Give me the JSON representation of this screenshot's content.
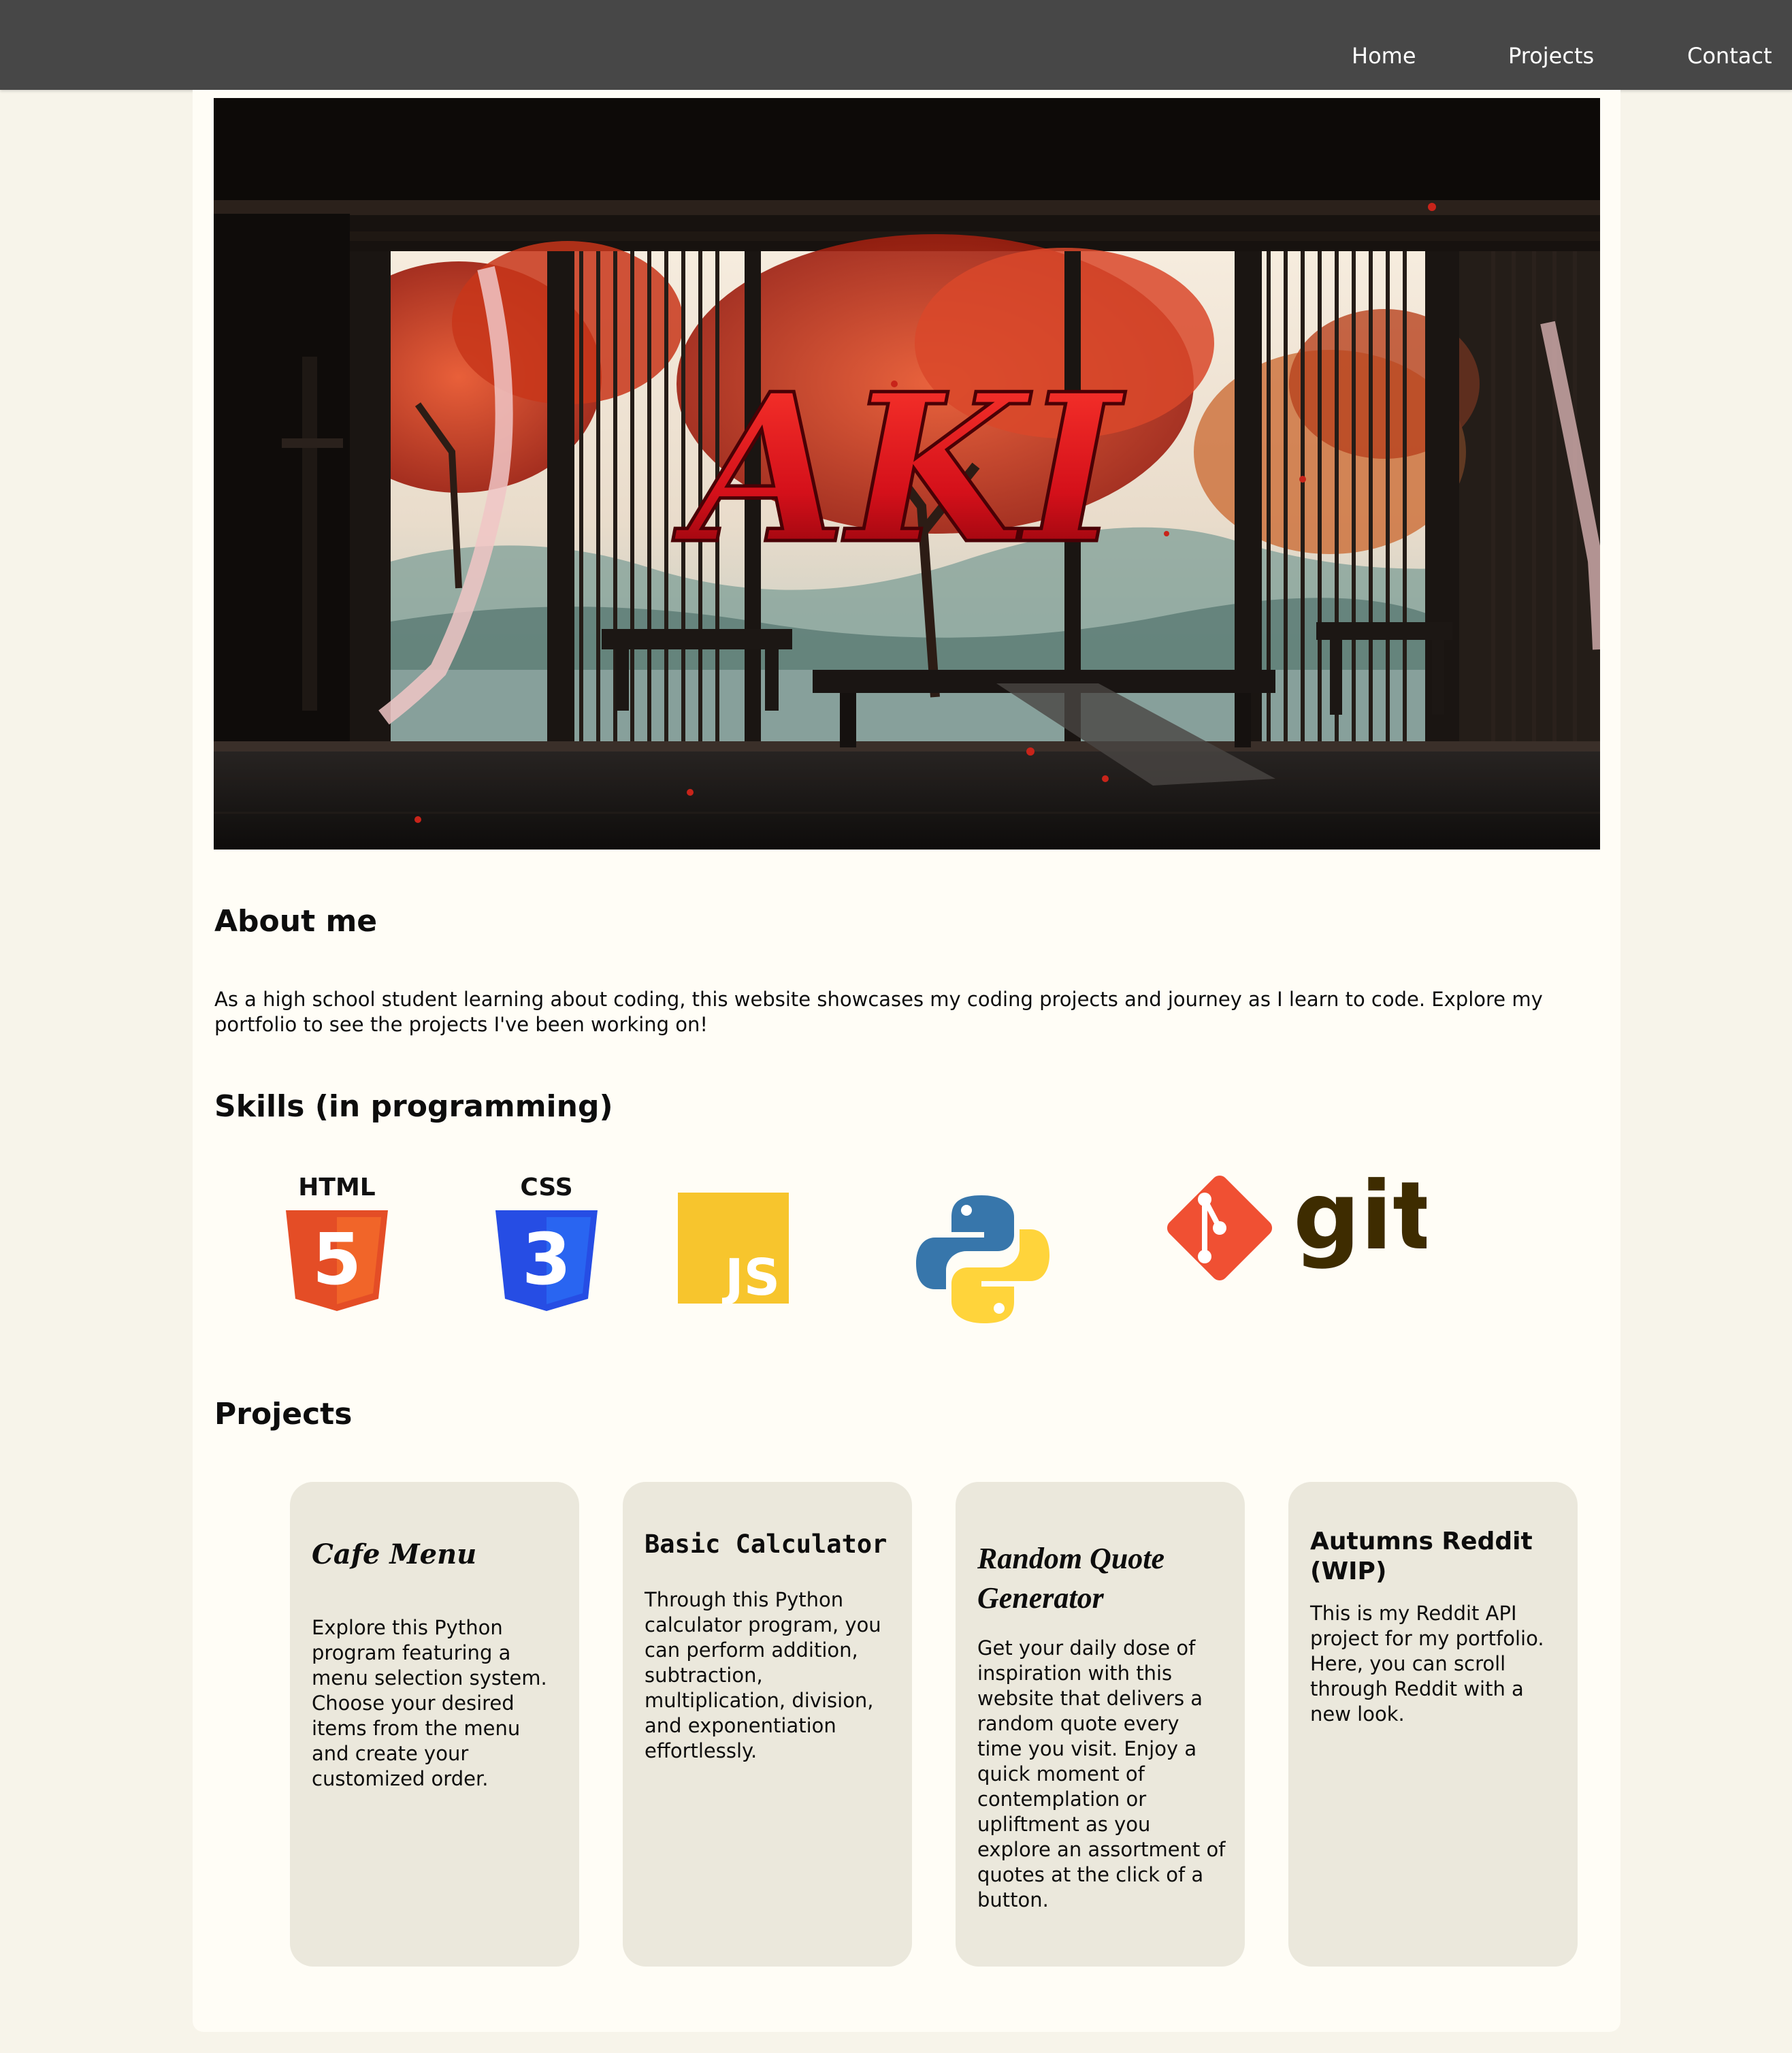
{
  "nav": {
    "items": [
      {
        "label": "Home"
      },
      {
        "label": "Projects"
      },
      {
        "label": "Contact"
      }
    ]
  },
  "hero": {
    "title": "AKI"
  },
  "about": {
    "heading": "About me",
    "text": "As a high school student learning about coding, this website showcases my coding projects and journey as I learn to code. Explore my portfolio to see the projects I've been working on!"
  },
  "skills": {
    "heading": "Skills (in programming)",
    "icons": [
      {
        "name": "html5-icon",
        "label": "HTML",
        "digit": "5",
        "color": "#e44d26"
      },
      {
        "name": "css3-icon",
        "label": "CSS",
        "digit": "3",
        "color": "#264de4"
      },
      {
        "name": "javascript-icon",
        "label": "JS",
        "color": "#f7c52d"
      },
      {
        "name": "python-icon",
        "blue": "#3776ab",
        "yellow": "#ffd43b"
      },
      {
        "name": "git-icon",
        "label": "git",
        "color": "#f05033",
        "text_color": "#3e2c00"
      }
    ]
  },
  "projects": {
    "heading": "Projects",
    "cards": [
      {
        "title": "Cafe Menu",
        "description": "Explore this Python program featuring a menu selection system. Choose your desired items from the menu and create your customized order."
      },
      {
        "title": "Basic Calculator",
        "description": "Through this Python calculator program, you can perform addition, subtraction, multiplication, division, and exponentiation effortlessly."
      },
      {
        "title": "Random Quote Generator",
        "description": "Get your daily dose of inspiration with this website that delivers a random quote every time you visit. Enjoy a quick moment of contemplation or upliftment as you explore an assortment of quotes at the click of a button."
      },
      {
        "title": "Autumns Reddit (WIP)",
        "description": "This is my Reddit API project for my portfolio. Here, you can scroll through Reddit with a new look."
      }
    ]
  },
  "colors": {
    "nav_bg": "#474747",
    "page_bg": "#f7f4ea",
    "panel_bg": "#fffdf6",
    "card_bg": "#ebe8dc",
    "hero_title": "#d4101a"
  }
}
